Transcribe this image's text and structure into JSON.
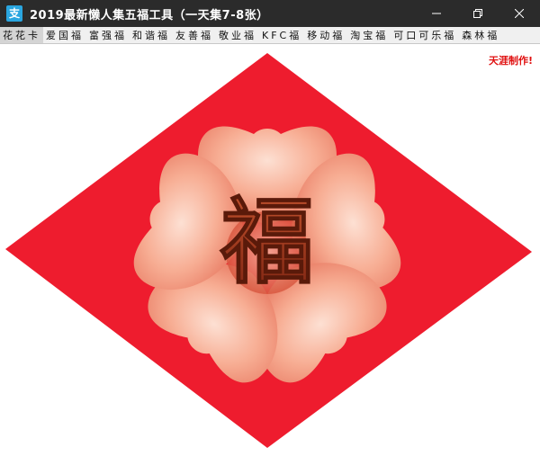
{
  "window": {
    "title": "2019最新懒人集五福工具（一天集7-8张）",
    "app_icon_glyph": "支",
    "app_icon_color": "#2aa6e0",
    "controls": [
      "minimize-icon",
      "restore-icon",
      "close-icon"
    ]
  },
  "tabs": [
    {
      "label": "花花卡",
      "active": true
    },
    {
      "label": "爱国福",
      "active": false
    },
    {
      "label": "富强福",
      "active": false
    },
    {
      "label": "和谐福",
      "active": false
    },
    {
      "label": "友善福",
      "active": false
    },
    {
      "label": "敬业福",
      "active": false
    },
    {
      "label": "KFC福",
      "active": false
    },
    {
      "label": "移动福",
      "active": false
    },
    {
      "label": "淘宝福",
      "active": false
    },
    {
      "label": "可口可乐福",
      "active": false
    },
    {
      "label": "森林福",
      "active": false
    }
  ],
  "content": {
    "author_text": "天涯制作!",
    "fu_character": "福",
    "colors": {
      "diamond": "#ee1c2e",
      "petal": "#f6a68a",
      "accent": "#e01010"
    }
  }
}
